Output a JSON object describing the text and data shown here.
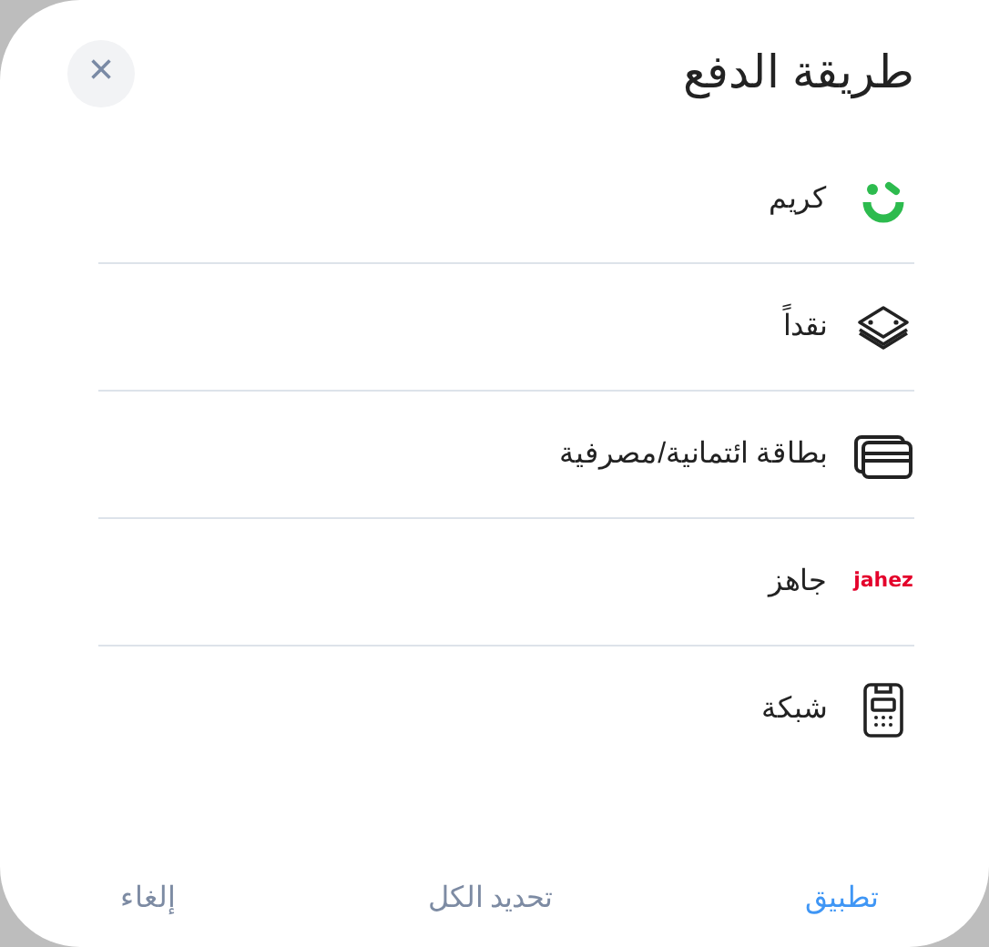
{
  "dialog": {
    "title": "طريقة الدفع",
    "close": "×"
  },
  "methods": [
    {
      "kind": "careem",
      "label": "كريم"
    },
    {
      "kind": "cash",
      "label": "نقداً"
    },
    {
      "kind": "card",
      "label": "بطاقة ائتمانية/مصرفية"
    },
    {
      "kind": "jahez",
      "label": "جاهز",
      "logo_text": "jahez"
    },
    {
      "kind": "network",
      "label": "شبكة"
    }
  ],
  "actions": [
    {
      "kind": "primary",
      "label": "تطبيق"
    },
    {
      "kind": "secondary",
      "label": "تحديد الكل"
    },
    {
      "kind": "secondary",
      "label": "إلغاء"
    }
  ]
}
